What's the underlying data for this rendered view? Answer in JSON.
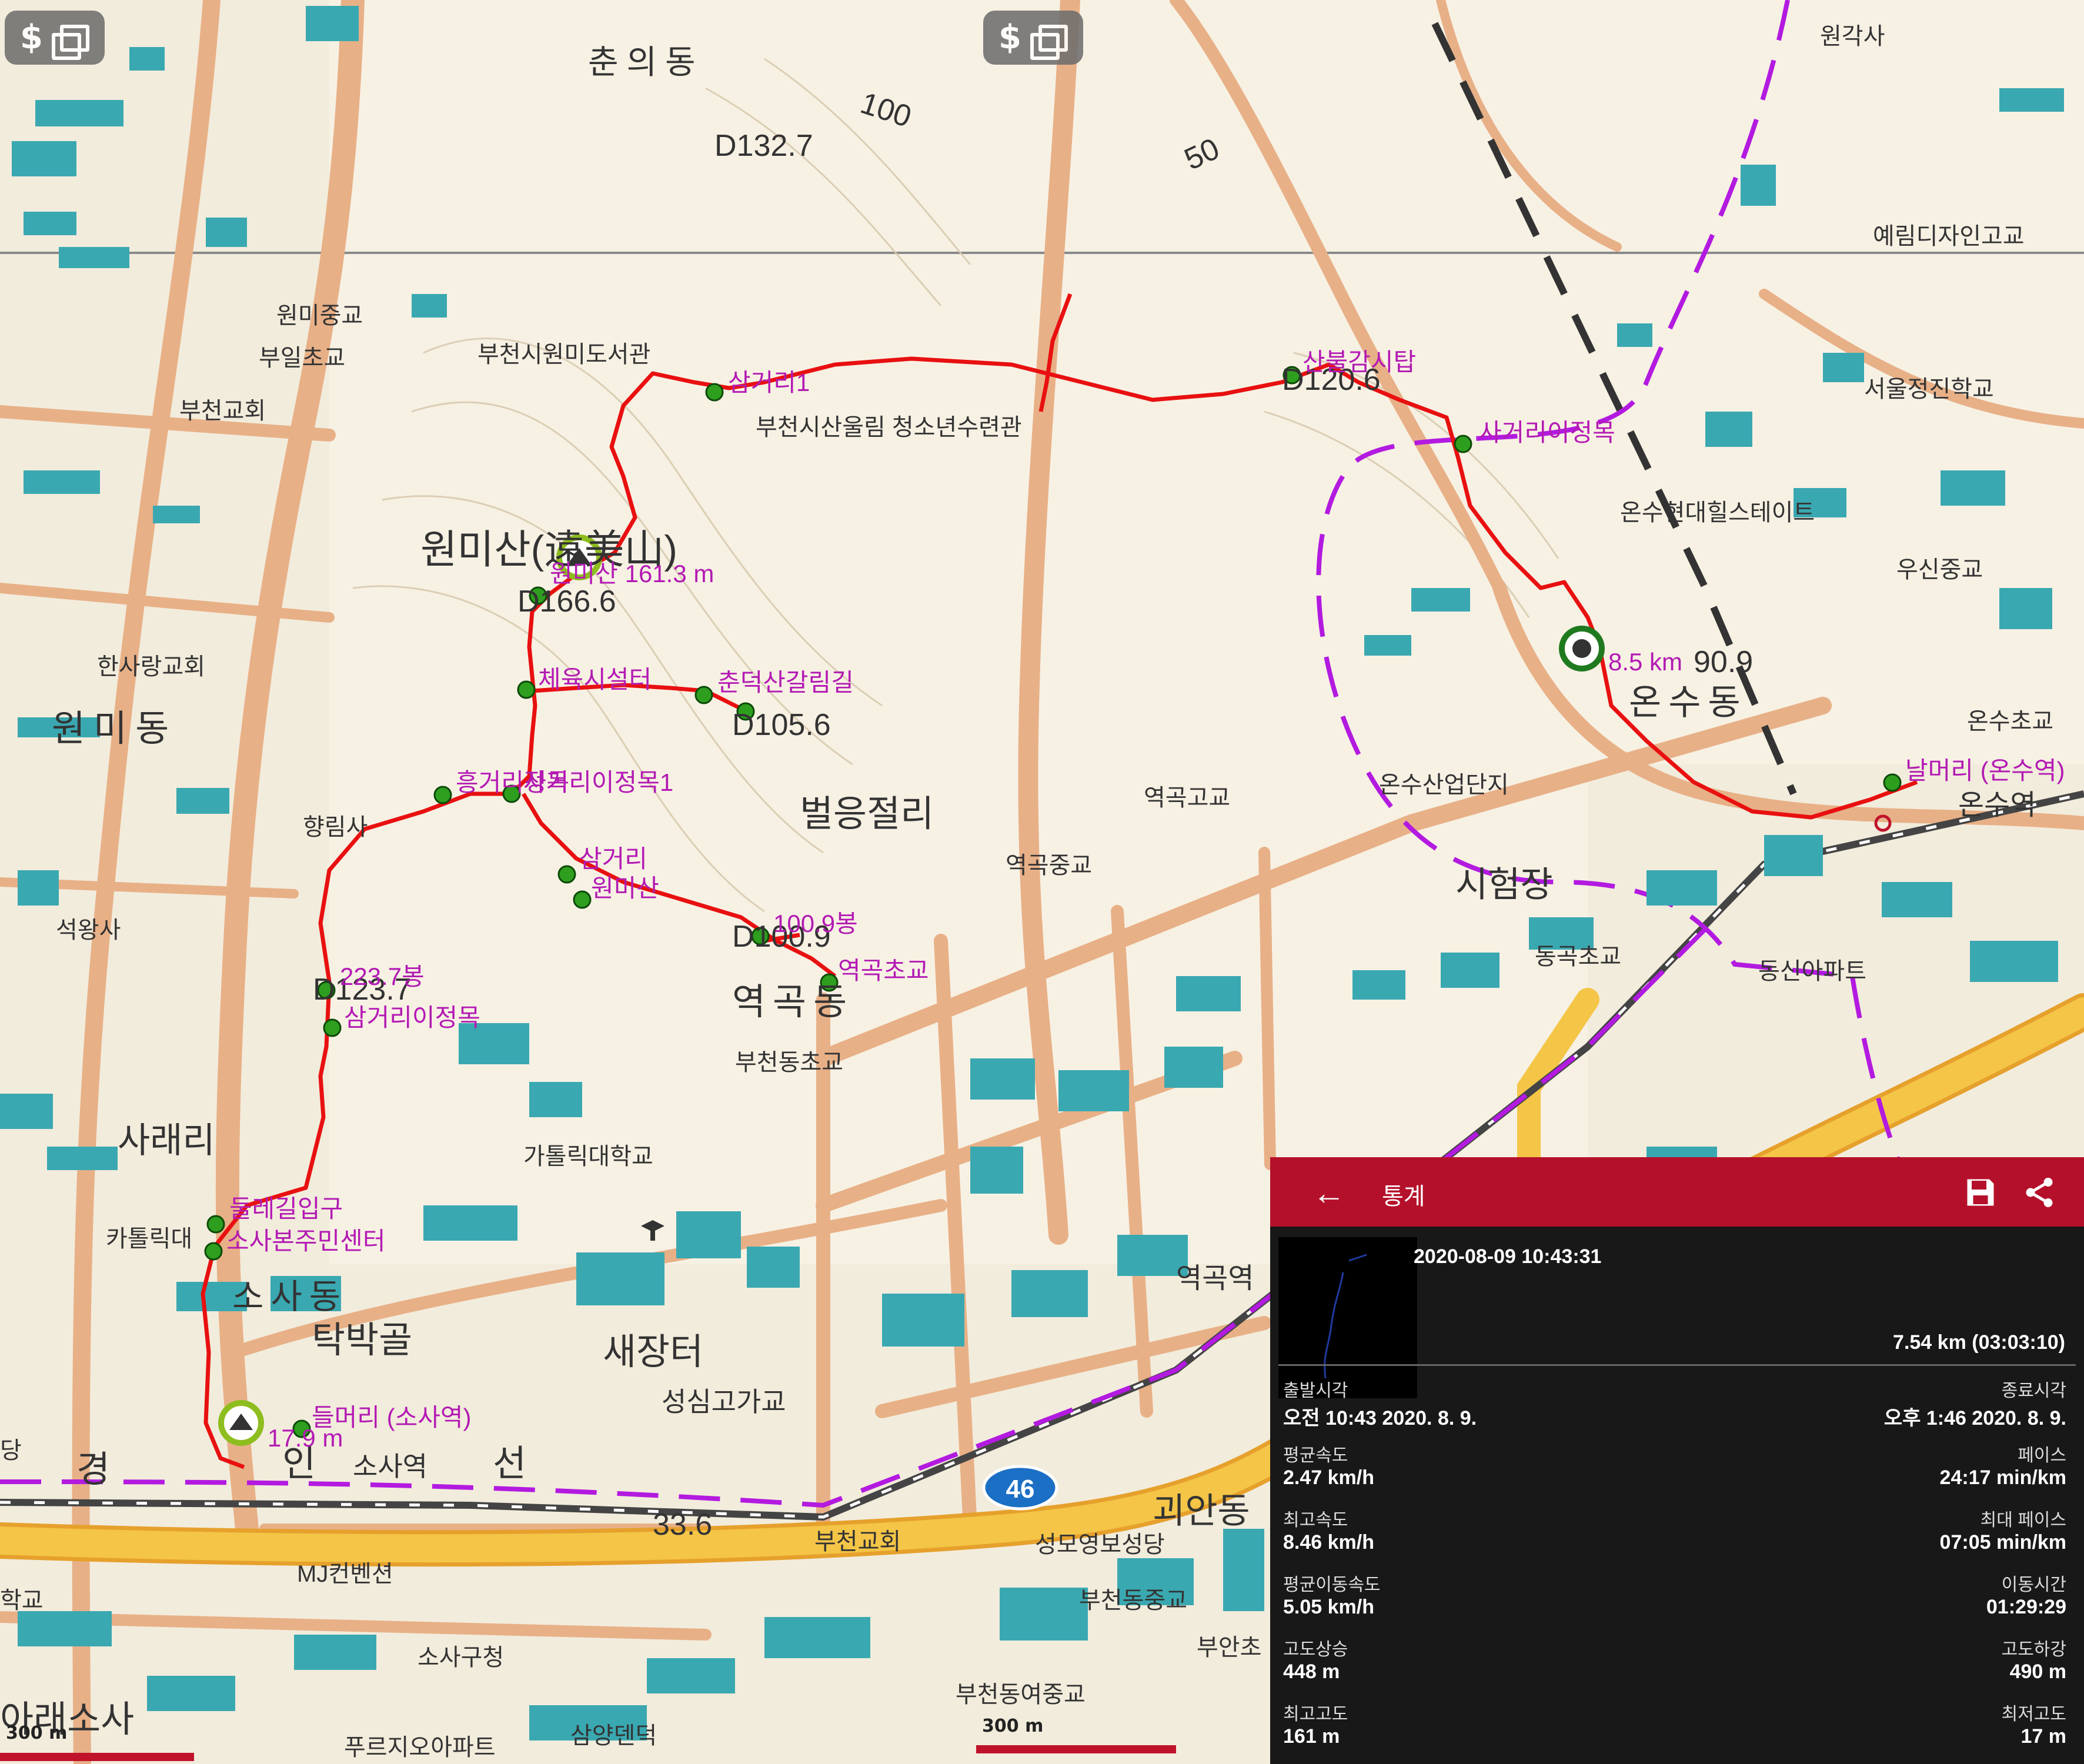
{
  "toolbar": {
    "layer_button_label": "$",
    "layer_icon": "layers-icon"
  },
  "map": {
    "place_labels": [
      "춘의동",
      "원미동",
      "원미산(遠美山)",
      "역곡동",
      "온수동",
      "소사동",
      "탁박골",
      "새장터",
      "벌응절리",
      "사래리",
      "경",
      "인",
      "선",
      "아래소사",
      "괴안동",
      "시험장"
    ],
    "poi_labels": [
      "원미중교",
      "부일초교",
      "부천교회",
      "한사랑교회",
      "향림사",
      "석왕사",
      "부천시원미도서관",
      "부천시산울림 청소년수련관",
      "온수현대힐스테이트",
      "서울정진학교",
      "예림디자인고교",
      "원각사",
      "우신중교",
      "온수초교",
      "온수역",
      "역곡고교",
      "역곡중교",
      "온수산업단지",
      "동곡초교",
      "동신아파트",
      "부천동초교",
      "가톨릭대학교",
      "카톨릭대",
      "역곡역",
      "성심고가교",
      "소사역",
      "MJ컨벤션",
      "소사구청",
      "푸르지오아파트",
      "삼양덴덕",
      "부천교회",
      "성모영보성당",
      "부천동중교",
      "부천동여중교",
      "부안초",
      "학교",
      "당"
    ],
    "elevation_labels": [
      "D132.7",
      "D166.6",
      "D105.6",
      "D100.9",
      "D123.7",
      "D120.6",
      "90.9"
    ],
    "contour_labels": [
      "100",
      "50",
      "33.6"
    ],
    "road_shield": "46",
    "waypoints": [
      {
        "name": "삼거리1",
        "id": "wp1"
      },
      {
        "name": "산불감시탑",
        "id": "wp2"
      },
      {
        "name": "사거리이정목",
        "id": "wp3"
      },
      {
        "name": "원미산 161.3 m",
        "id": "wp4"
      },
      {
        "name": "체육시설터",
        "id": "wp5"
      },
      {
        "name": "춘덕산갈림길",
        "id": "wp6"
      },
      {
        "name": "흥거리정목",
        "id": "wp7"
      },
      {
        "name": "사거리이정목1",
        "id": "wp8"
      },
      {
        "name": "삼거리",
        "id": "wp9"
      },
      {
        "name": "원미산",
        "id": "wp10"
      },
      {
        "name": "100.9봉",
        "id": "wp11"
      },
      {
        "name": "역곡초교",
        "id": "wp12"
      },
      {
        "name": "223.7봉",
        "id": "wp13"
      },
      {
        "name": "삼거리이정목",
        "id": "wp14"
      },
      {
        "name": "둘레길입구",
        "id": "wp15"
      },
      {
        "name": "소사본주민센터",
        "id": "wp16"
      },
      {
        "name": "들머리 (소사역)",
        "id": "wp17"
      },
      {
        "name": "17.9 m",
        "id": "wp18"
      },
      {
        "name": "8.5 km",
        "id": "wp19"
      },
      {
        "name": "날머리 (온수역)",
        "id": "wp20"
      }
    ]
  },
  "scales": [
    {
      "label": "300 m"
    },
    {
      "label": "300 m"
    }
  ],
  "stats": {
    "title": "통계",
    "datetime": "2020-08-09 10:43:31",
    "distance": "7.54 km (03:03:10)",
    "rows": [
      {
        "l1": "출발시각",
        "v1": "오전 10:43 2020. 8. 9.",
        "l2": "종료시각",
        "v2": "오후 1:46 2020. 8. 9."
      },
      {
        "l1": "평균속도",
        "v1": "2.47 km/h",
        "l2": "페이스",
        "v2": "24:17 min/km"
      },
      {
        "l1": "최고속도",
        "v1": "8.46 km/h",
        "l2": "최대 페이스",
        "v2": "07:05 min/km"
      },
      {
        "l1": "평균이동속도",
        "v1": "5.05 km/h",
        "l2": "이동시간",
        "v2": "01:29:29"
      },
      {
        "l1": "고도상승",
        "v1": "448 m",
        "l2": "고도하강",
        "v2": "490 m"
      },
      {
        "l1": "최고고도",
        "v1": "161 m",
        "l2": "최저고도",
        "v2": "17 m"
      }
    ]
  },
  "colors": {
    "route": "#e81010",
    "waypoint": "#2e9e1e",
    "waypoint_text": "#b31ab3",
    "boundary": "#b31ae0",
    "header": "#b5102b"
  }
}
